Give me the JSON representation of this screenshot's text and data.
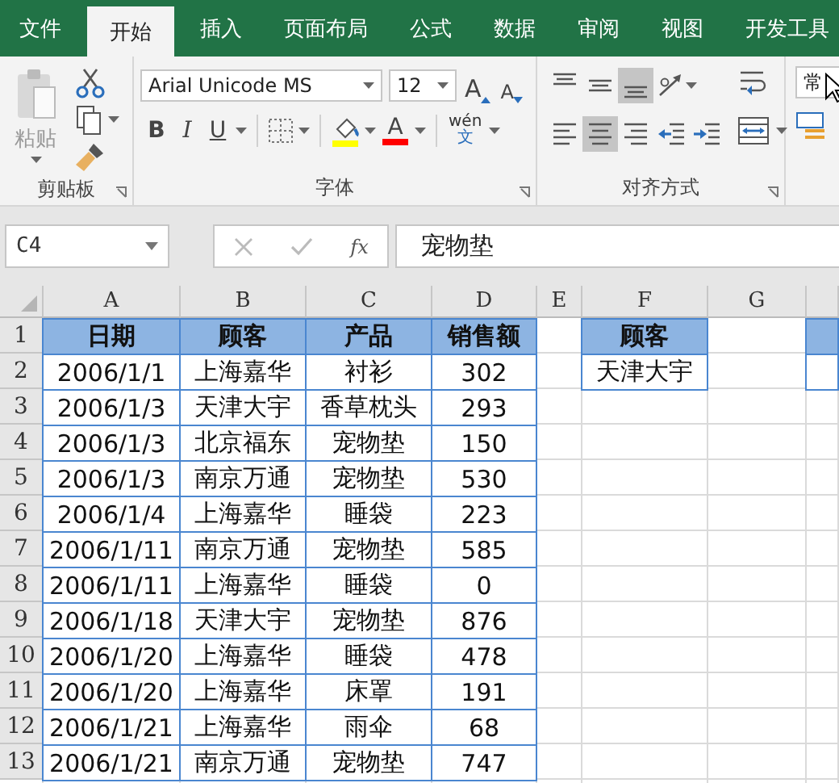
{
  "tabs": [
    {
      "label": "文件",
      "selected": false
    },
    {
      "label": "开始",
      "selected": true
    },
    {
      "label": "插入",
      "selected": false
    },
    {
      "label": "页面布局",
      "selected": false
    },
    {
      "label": "公式",
      "selected": false
    },
    {
      "label": "数据",
      "selected": false
    },
    {
      "label": "审阅",
      "selected": false
    },
    {
      "label": "视图",
      "selected": false
    },
    {
      "label": "开发工具",
      "selected": false
    }
  ],
  "ribbon": {
    "clipboard": {
      "paste_label": "粘贴",
      "group_label": "剪贴板"
    },
    "font": {
      "font_name": "Arial Unicode MS",
      "font_size": "12",
      "grow_label": "A",
      "shrink_label": "A",
      "bold_label": "B",
      "italic_label": "I",
      "underline_label": "U",
      "font_color_label": "A",
      "phonetic_top": "wén",
      "phonetic_bottom": "文",
      "group_label": "字体"
    },
    "alignment": {
      "buttons": [
        {
          "kind": "top",
          "selected": false
        },
        {
          "kind": "middle",
          "selected": false
        },
        {
          "kind": "bottom",
          "selected": true
        },
        {
          "kind": "orientation",
          "selected": false
        },
        {
          "kind": "left",
          "selected": false
        },
        {
          "kind": "center",
          "selected": true
        },
        {
          "kind": "right",
          "selected": false
        },
        {
          "kind": "indent_decrease",
          "selected": false
        },
        {
          "kind": "indent_increase",
          "selected": false
        }
      ],
      "group_label": "对齐方式"
    },
    "number": {
      "format": "常"
    }
  },
  "formula_bar": {
    "name_box": "C4",
    "fx_label": "fx",
    "formula": "宠物垫"
  },
  "sheet": {
    "columns": [
      "A",
      "B",
      "C",
      "D",
      "E",
      "F",
      "G"
    ],
    "row_numbers": [
      "1",
      "2",
      "3",
      "4",
      "5",
      "6",
      "7",
      "8",
      "9",
      "10",
      "11",
      "12",
      "13"
    ],
    "main_table": {
      "header": [
        "日期",
        "顾客",
        "产品",
        "销售额"
      ],
      "rows": [
        [
          "2006/1/1",
          "上海嘉华",
          "衬衫",
          "302"
        ],
        [
          "2006/1/3",
          "天津大宇",
          "香草枕头",
          "293"
        ],
        [
          "2006/1/3",
          "北京福东",
          "宠物垫",
          "150"
        ],
        [
          "2006/1/3",
          "南京万通",
          "宠物垫",
          "530"
        ],
        [
          "2006/1/4",
          "上海嘉华",
          "睡袋",
          "223"
        ],
        [
          "2006/1/11",
          "南京万通",
          "宠物垫",
          "585"
        ],
        [
          "2006/1/11",
          "上海嘉华",
          "睡袋",
          "0"
        ],
        [
          "2006/1/18",
          "天津大宇",
          "宠物垫",
          "876"
        ],
        [
          "2006/1/20",
          "上海嘉华",
          "睡袋",
          "478"
        ],
        [
          "2006/1/20",
          "上海嘉华",
          "床罩",
          "191"
        ],
        [
          "2006/1/21",
          "上海嘉华",
          "雨伞",
          "68"
        ],
        [
          "2006/1/21",
          "南京万通",
          "宠物垫",
          "747"
        ]
      ]
    },
    "criteria_table": {
      "header": [
        "顾客"
      ],
      "rows": [
        [
          "天津大宇"
        ]
      ]
    }
  }
}
